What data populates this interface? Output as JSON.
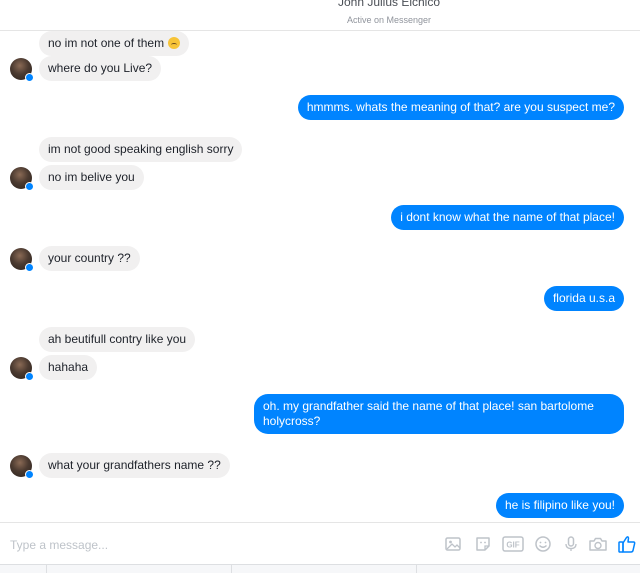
{
  "header": {
    "name": "John Julius Elchico",
    "status": "Active on Messenger"
  },
  "messages": [
    {
      "side": "in",
      "text": "no im not one of them",
      "emoji": "disappointed-face"
    },
    {
      "side": "in",
      "text": "where do you Live?"
    },
    {
      "side": "out",
      "text": "hmmms. whats the meaning of that? are you suspect me?"
    },
    {
      "side": "in",
      "text": "im not good speaking english sorry"
    },
    {
      "side": "in",
      "text": "no im belive you"
    },
    {
      "side": "out",
      "text": "i dont know what the name of that place!"
    },
    {
      "side": "in",
      "text": "your country ??"
    },
    {
      "side": "out",
      "text": "florida u.s.a"
    },
    {
      "side": "in",
      "text": "ah beutifull contry like you"
    },
    {
      "side": "in",
      "text": "hahaha"
    },
    {
      "side": "out",
      "text": "oh. my grandfather said the name of that place! san bartolome holycross?"
    },
    {
      "side": "in",
      "text": "what your grandfathers name ??"
    },
    {
      "side": "out",
      "text": "he is filipino like you!"
    }
  ],
  "composer": {
    "placeholder": "Type a message...",
    "tools": [
      "image-icon",
      "sticker-icon",
      "gif-icon",
      "emoji-icon",
      "microphone-icon",
      "camera-icon",
      "thumbs-up-icon"
    ],
    "gif_label": "GIF"
  },
  "colors": {
    "outgoing": "#0084ff",
    "incoming": "#f1f0f0",
    "tool": "#bec3c9",
    "like": "#0084ff"
  }
}
